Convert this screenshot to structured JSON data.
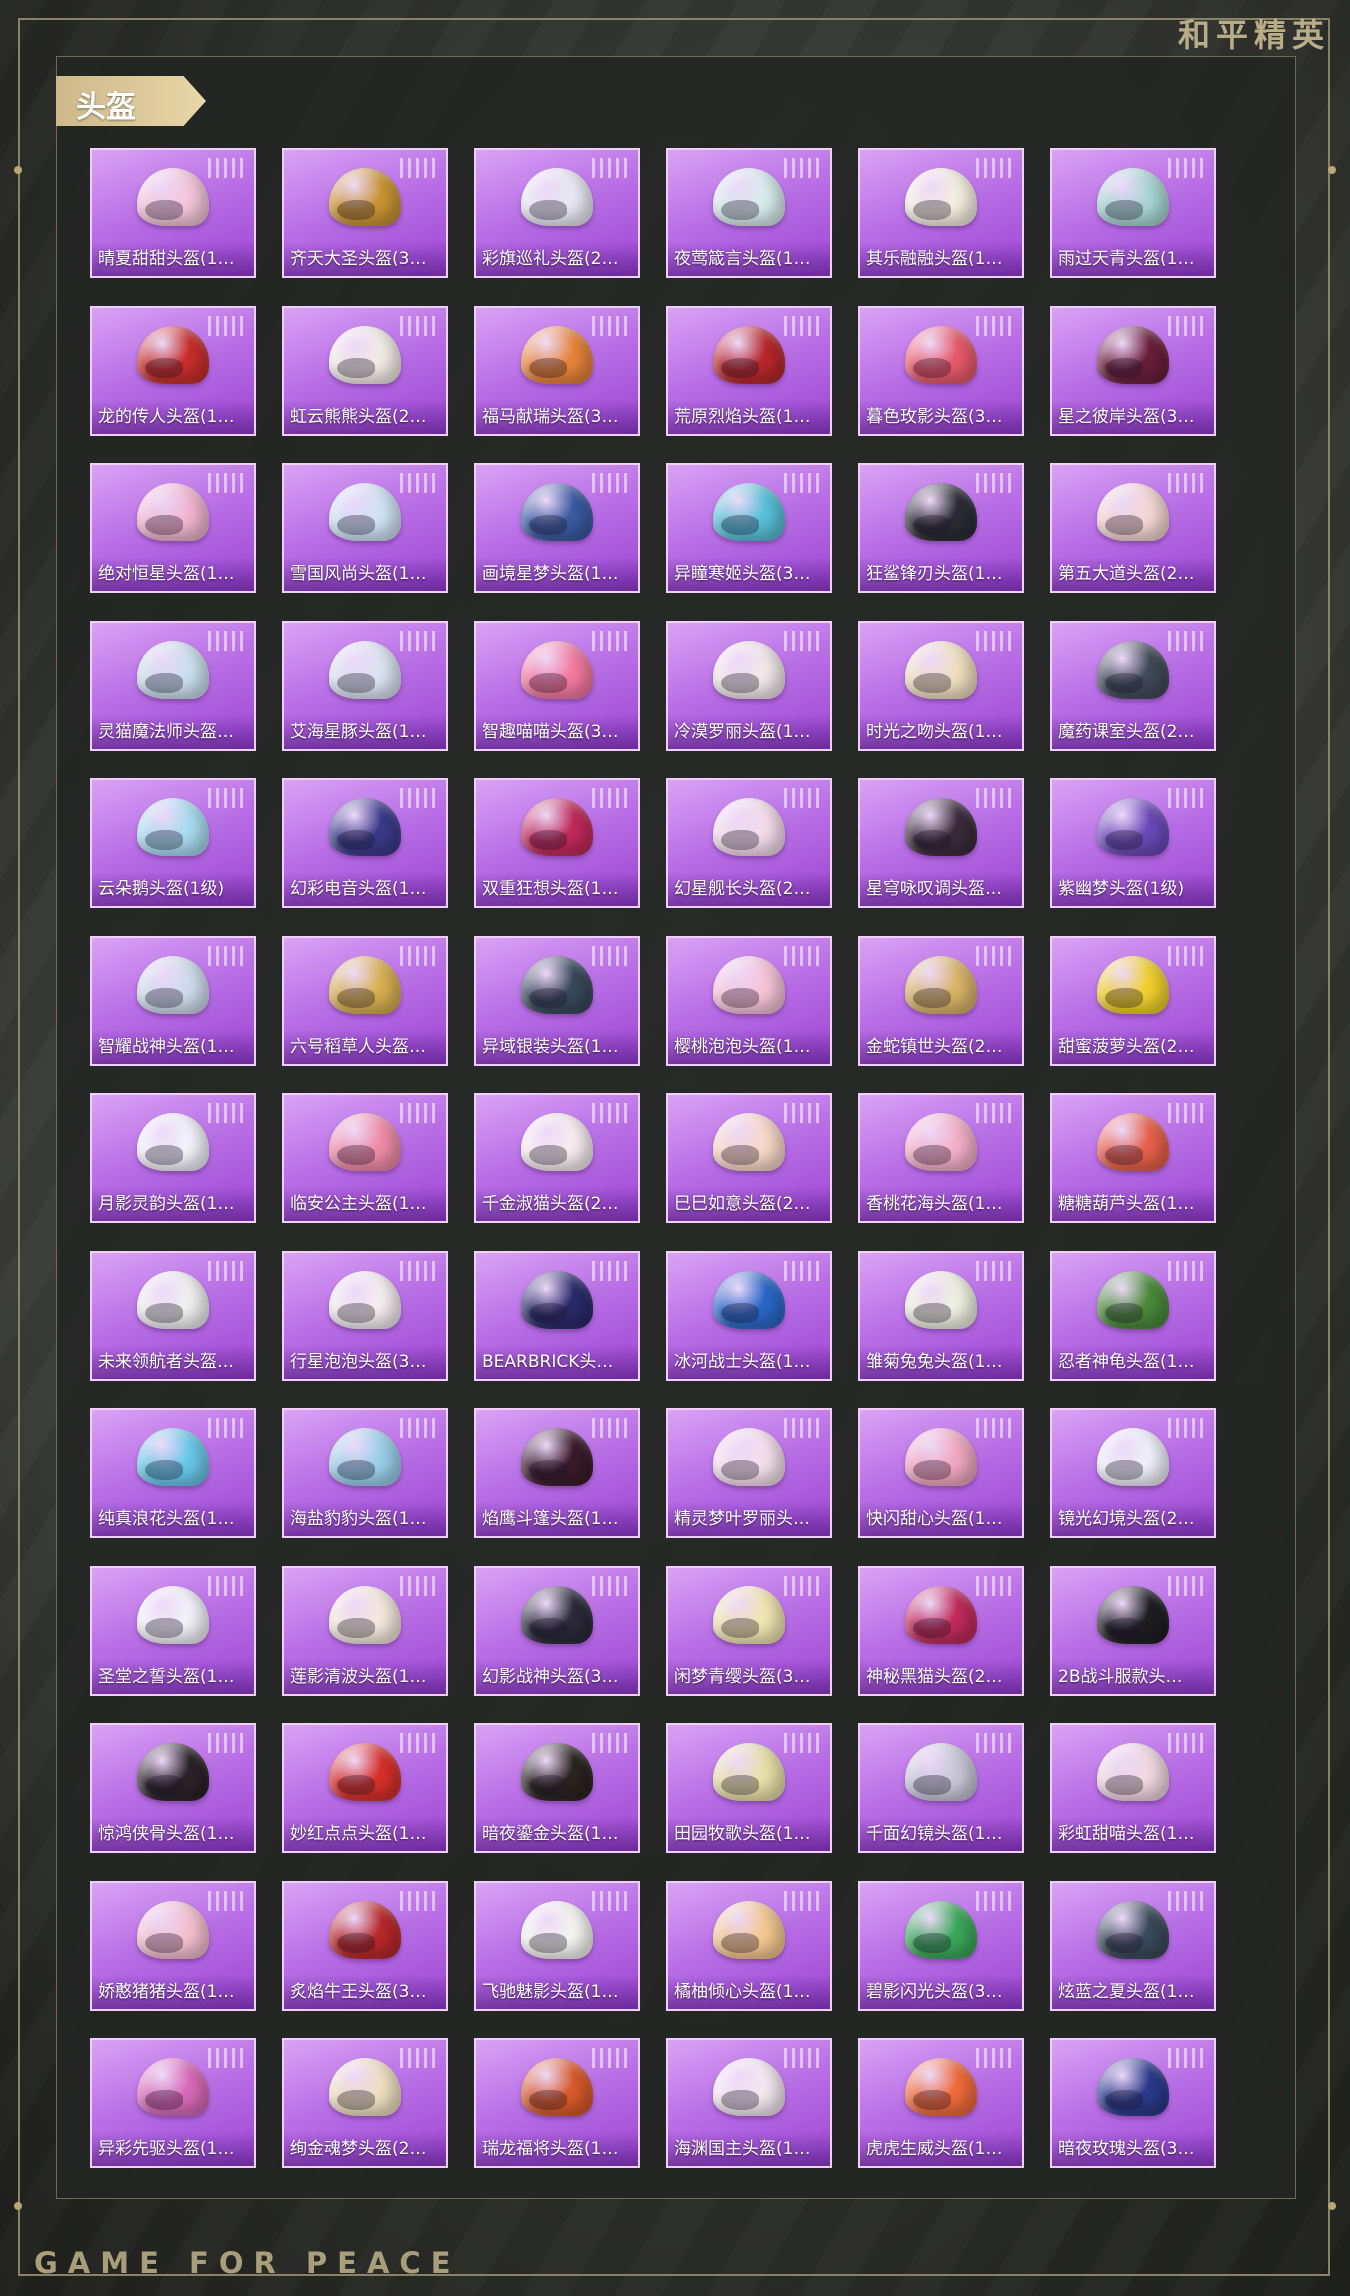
{
  "brand": {
    "cn": "和平精英",
    "en": "GAME FOR PEACE"
  },
  "section": {
    "title": "头盔"
  },
  "colors": {
    "card_accent": "#b970e6",
    "tag_gold": "#d9c596"
  },
  "items": [
    {
      "name": "晴夏甜甜头盔(1…",
      "color": "#f4c6da"
    },
    {
      "name": "齐天大圣头盔(3…",
      "color": "#c99434"
    },
    {
      "name": "彩旗巡礼头盔(2…",
      "color": "#e8e8f2"
    },
    {
      "name": "夜莺箴言头盔(1…",
      "color": "#d8ecec"
    },
    {
      "name": "其乐融融头盔(1…",
      "color": "#f4efe0"
    },
    {
      "name": "雨过天青头盔(1…",
      "color": "#a8d6d4"
    },
    {
      "name": "龙的传人头盔(1…",
      "color": "#c82e2a"
    },
    {
      "name": "虹云熊熊头盔(2…",
      "color": "#f2ece6"
    },
    {
      "name": "福马献瑞头盔(3…",
      "color": "#e8843a"
    },
    {
      "name": "荒原烈焰头盔(1…",
      "color": "#b8282c"
    },
    {
      "name": "暮色玫影头盔(3…",
      "color": "#e85a6a"
    },
    {
      "name": "星之彼岸头盔(3…",
      "color": "#6a1e3a"
    },
    {
      "name": "绝对恒星头盔(1…",
      "color": "#f2b6d0"
    },
    {
      "name": "雪国风尚头盔(1…",
      "color": "#cfe2f4"
    },
    {
      "name": "画境星梦头盔(1…",
      "color": "#3a5aa0"
    },
    {
      "name": "异瞳寒姬头盔(3…",
      "color": "#58c0d8"
    },
    {
      "name": "狂鲨锋刃头盔(1…",
      "color": "#2a2c34"
    },
    {
      "name": "第五大道头盔(2…",
      "color": "#f4d6d2"
    },
    {
      "name": "灵猫魔法师头盔…",
      "color": "#cbe0ee"
    },
    {
      "name": "艾海星豚头盔(1…",
      "color": "#dce4f2"
    },
    {
      "name": "智趣喵喵头盔(3…",
      "color": "#f47aa0"
    },
    {
      "name": "冷漠罗丽头盔(1…",
      "color": "#f2e8ea"
    },
    {
      "name": "时光之吻头盔(1…",
      "color": "#f0e0c0"
    },
    {
      "name": "魔药课室头盔(2…",
      "color": "#404a58"
    },
    {
      "name": "云朵鹅头盔(1级)",
      "color": "#a8dcf0"
    },
    {
      "name": "幻彩电音头盔(1…",
      "color": "#3a3a8a"
    },
    {
      "name": "双重狂想头盔(1…",
      "color": "#c02a5a"
    },
    {
      "name": "幻星舰长头盔(2…",
      "color": "#f4dcea"
    },
    {
      "name": "星穹咏叹调头盔…",
      "color": "#3a2a3a"
    },
    {
      "name": "紫幽梦头盔(1级)",
      "color": "#6a4ab8"
    },
    {
      "name": "智耀战神头盔(1…",
      "color": "#cfdcec"
    },
    {
      "name": "六号稻草人头盔…",
      "color": "#d8b050"
    },
    {
      "name": "异域银装头盔(1…",
      "color": "#38485a"
    },
    {
      "name": "樱桃泡泡头盔(1…",
      "color": "#f6c4d8"
    },
    {
      "name": "金蛇镇世头盔(2…",
      "color": "#d8b468"
    },
    {
      "name": "甜蜜菠萝头盔(2…",
      "color": "#f0d02a"
    },
    {
      "name": "月影灵韵头盔(1…",
      "color": "#f2f2fa"
    },
    {
      "name": "临安公主头盔(1…",
      "color": "#f08ca8"
    },
    {
      "name": "千金淑猫头盔(2…",
      "color": "#f8ecf0"
    },
    {
      "name": "巳巳如意头盔(2…",
      "color": "#f8d8c8"
    },
    {
      "name": "香桃花海头盔(1…",
      "color": "#f4b0c8"
    },
    {
      "name": "糖糖葫芦头盔(1…",
      "color": "#e8604a"
    },
    {
      "name": "未来领航者头盔…",
      "color": "#f0f0f0"
    },
    {
      "name": "行星泡泡头盔(3…",
      "color": "#f4eef0"
    },
    {
      "name": "BEARBRICK头…",
      "color": "#2a2a6a"
    },
    {
      "name": "冰河战士头盔(1…",
      "color": "#2a68c8"
    },
    {
      "name": "雏菊兔兔头盔(1…",
      "color": "#eef0e0"
    },
    {
      "name": "忍者神龟头盔(1…",
      "color": "#4a8a3a"
    },
    {
      "name": "纯真浪花头盔(1…",
      "color": "#6ac8ea"
    },
    {
      "name": "海盐豹豹头盔(1…",
      "color": "#9ad0ea"
    },
    {
      "name": "焰鹰斗篷头盔(1…",
      "color": "#3a1a2a"
    },
    {
      "name": "精灵梦叶罗丽头…",
      "color": "#f4e0ec"
    },
    {
      "name": "快闪甜心头盔(1…",
      "color": "#f0a8c0"
    },
    {
      "name": "镜光幻境头盔(2…",
      "color": "#eef0f8"
    },
    {
      "name": "圣堂之誓头盔(1…",
      "color": "#f2f2f8"
    },
    {
      "name": "莲影清波头盔(1…",
      "color": "#f4e8dc"
    },
    {
      "name": "幻影战神头盔(3…",
      "color": "#2a2a3a"
    },
    {
      "name": "闲梦青缨头盔(3…",
      "color": "#f0e6b0"
    },
    {
      "name": "神秘黑猫头盔(2…",
      "color": "#c02a5a"
    },
    {
      "name": "2B战斗服款头…",
      "color": "#1e1e22"
    },
    {
      "name": "惊鸿侠骨头盔(1…",
      "color": "#2a2228"
    },
    {
      "name": "妙红点点头盔(1…",
      "color": "#d8302a"
    },
    {
      "name": "暗夜鎏金头盔(1…",
      "color": "#2a2420"
    },
    {
      "name": "田园牧歌头盔(1…",
      "color": "#e8e0a8"
    },
    {
      "name": "千面幻镜头盔(1…",
      "color": "#c8c8d8"
    },
    {
      "name": "彩虹甜喵头盔(1…",
      "color": "#f0d8e0"
    },
    {
      "name": "娇憨猪猪头盔(1…",
      "color": "#f4c0d0"
    },
    {
      "name": "炙焰牛王头盔(3…",
      "color": "#b8282a"
    },
    {
      "name": "飞驰魅影头盔(1…",
      "color": "#f4f4f0"
    },
    {
      "name": "橘柚倾心头盔(1…",
      "color": "#f4c890"
    },
    {
      "name": "碧影闪光头盔(3…",
      "color": "#3aa85a"
    },
    {
      "name": "炫蓝之夏头盔(1…",
      "color": "#3a4a5a"
    },
    {
      "name": "异彩先驱头盔(1…",
      "color": "#d86ab8"
    },
    {
      "name": "绚金魂梦头盔(2…",
      "color": "#eee0c0"
    },
    {
      "name": "瑞龙福将头盔(1…",
      "color": "#d85a2a"
    },
    {
      "name": "海渊国主头盔(1…",
      "color": "#f4e8f0"
    },
    {
      "name": "虎虎生威头盔(1…",
      "color": "#f06a3a"
    },
    {
      "name": "暗夜玫瑰头盔(3…",
      "color": "#2a3a8a"
    }
  ]
}
